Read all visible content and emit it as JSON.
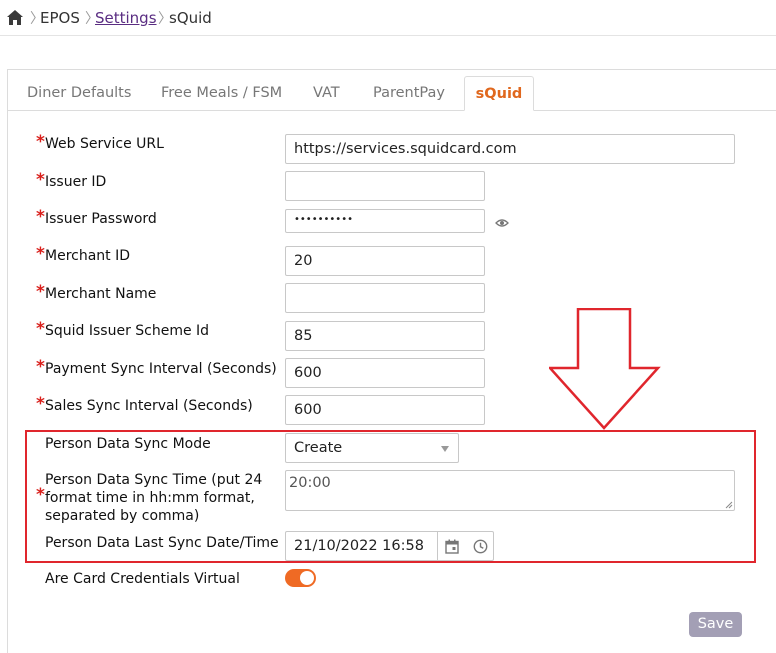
{
  "breadcrumb": {
    "items": [
      "EPOS",
      "Settings",
      "sQuid"
    ]
  },
  "tabs": [
    {
      "label": "Diner Defaults"
    },
    {
      "label": "Free Meals / FSM"
    },
    {
      "label": "VAT"
    },
    {
      "label": "ParentPay"
    },
    {
      "label": "sQuid",
      "active": true
    }
  ],
  "form": {
    "required_marker": "*",
    "web_service_url": {
      "label": "Web Service URL",
      "value": "https://services.squidcard.com"
    },
    "issuer_id": {
      "label": "Issuer ID",
      "value": ""
    },
    "issuer_password": {
      "label": "Issuer Password",
      "value": "••••••••••"
    },
    "merchant_id": {
      "label": "Merchant ID",
      "value": "20"
    },
    "merchant_name": {
      "label": "Merchant Name",
      "value": ""
    },
    "scheme_id": {
      "label": "Squid Issuer Scheme Id",
      "value": "85"
    },
    "payment_sync": {
      "label": "Payment Sync Interval (Seconds)",
      "value": "600"
    },
    "sales_sync": {
      "label": "Sales Sync Interval (Seconds)",
      "value": "600"
    },
    "person_sync_mode": {
      "label": "Person Data Sync Mode",
      "value": "Create"
    },
    "person_sync_time": {
      "label_lines": [
        "Person Data Sync Time (put 24",
        "format time in hh:mm format,",
        "separated by comma)"
      ],
      "value": "20:00"
    },
    "person_last_sync": {
      "label": "Person Data Last Sync Date/Time",
      "value": "21/10/2022 16:58"
    },
    "card_virtual": {
      "label": "Are Card Credentials Virtual",
      "enabled": true
    }
  },
  "actions": {
    "save_label": "Save"
  },
  "icons": [
    "home-icon",
    "eye-icon",
    "calendar-icon",
    "clock-icon",
    "chevron-down-icon"
  ],
  "colors": {
    "accent": "#ef6a24",
    "required": "#d9201c",
    "highlight": "#e0262d",
    "link": "#5a2d82",
    "save_button": "#a39fb5"
  }
}
